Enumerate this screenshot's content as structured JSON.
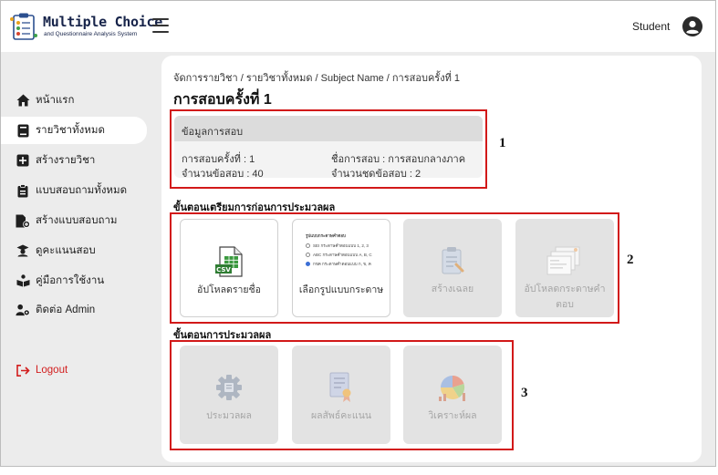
{
  "app": {
    "brand_title": "Multiple Choice",
    "brand_subtitle": "and Questionnaire Analysis System",
    "user_label": "Student"
  },
  "sidebar": {
    "items": [
      {
        "label": "หน้าแรก",
        "icon": "home-icon",
        "active": false
      },
      {
        "label": "รายวิชาทั้งหมด",
        "icon": "book-icon",
        "active": true
      },
      {
        "label": "สร้างรายวิชา",
        "icon": "add-square-icon",
        "active": false
      },
      {
        "label": "แบบสอบถามทั้งหมด",
        "icon": "clipboard-icon",
        "active": false
      },
      {
        "label": "สร้างแบบสอบถาม",
        "icon": "add-file-icon",
        "active": false
      },
      {
        "label": "ดูคะแนนสอบ",
        "icon": "graduate-icon",
        "active": false
      },
      {
        "label": "คู่มือการใช้งาน",
        "icon": "reading-icon",
        "active": false
      },
      {
        "label": "ติดต่อ Admin",
        "icon": "user-gear-icon",
        "active": false
      }
    ],
    "logout_label": "Logout"
  },
  "main": {
    "breadcrumb": "จัดการรายวิชา / รายวิชาทั้งหมด / Subject Name / การสอบครั้งที่ 1",
    "title": "การสอบครั้งที่ 1",
    "info": {
      "heading": "ข้อมูลการสอบ",
      "exam_number": "การสอบครั้งที่ : 1",
      "exam_name": "ชื่อการสอบ : การสอบกลางภาค",
      "question_count": "จำนวนข้อสอบ : 40",
      "set_count": "จำนวนชุดข้อสอบ : 2"
    },
    "prep_section_title": "ขั้นตอนเตรียมการก่อนการประมวลผล",
    "prep_tiles": [
      {
        "label": "อัปโหลดรายชื่อ",
        "icon": "csv-file-icon",
        "enabled": true
      },
      {
        "label": "เลือกรูปแบบกระดาษ",
        "icon": "paper-format-preview",
        "enabled": true
      },
      {
        "label": "สร้างเฉลย",
        "icon": "answer-key-icon",
        "enabled": false
      },
      {
        "label": "อัปโหลดกระดาษคำตอบ",
        "icon": "answer-sheets-icon",
        "enabled": false
      }
    ],
    "paper_preview": {
      "title": "รูปแบบกระดาษคำตอบ",
      "options": [
        {
          "text": "SEI กระดาษคำตอบแบบ 1, 2, 3",
          "selected": false
        },
        {
          "text": "ABC กระดาษคำตอบแบบ A, B, C",
          "selected": false
        },
        {
          "text": "กขค กระดาษคำตอบแบบ ก, ข, ค",
          "selected": true
        }
      ]
    },
    "process_section_title": "ขั้นตอนการประมวลผล",
    "process_tiles": [
      {
        "label": "ประมวลผล",
        "icon": "process-gear-icon",
        "enabled": false
      },
      {
        "label": "ผลสัพธ์คะแนน",
        "icon": "certificate-icon",
        "enabled": false
      },
      {
        "label": "วิเคราะห์ผล",
        "icon": "analysis-chart-icon",
        "enabled": false
      }
    ]
  },
  "annotations": [
    "1",
    "2",
    "3"
  ],
  "colors": {
    "accent_red": "#d21919",
    "brand_navy": "#17244a",
    "logout_red": "#d21e1e"
  }
}
